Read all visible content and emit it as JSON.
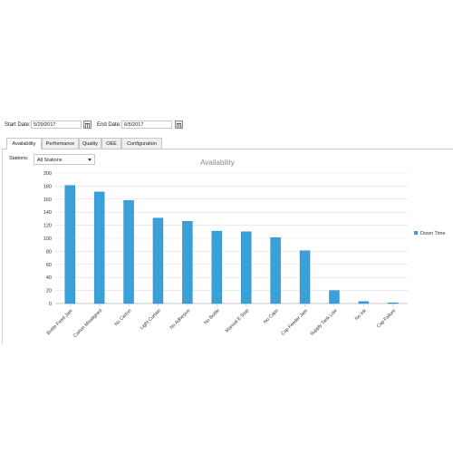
{
  "filters": {
    "start_label": "Start Date:",
    "start_value": "5/29/2017",
    "end_label": "End Date:",
    "end_value": "6/5/2017"
  },
  "tabs": [
    {
      "label": "Availability",
      "active": true
    },
    {
      "label": "Performance",
      "active": false
    },
    {
      "label": "Quality",
      "active": false
    },
    {
      "label": "OEE",
      "active": false
    },
    {
      "label": "Configuration",
      "active": false
    }
  ],
  "stations": {
    "label": "Stations:",
    "selected": "All Stations"
  },
  "colors": {
    "bar": "#3aa0d8",
    "bar_edge": "#1f7fbf",
    "grid": "#e2e2e2",
    "title": "#888888"
  },
  "chart_data": {
    "type": "bar",
    "title": "Availability",
    "categories": [
      "Bottle Feed Jam",
      "Carton Misaligned",
      "No Carton",
      "Light Curtain",
      "No Adhesive",
      "No Bottle",
      "Manual E Stop",
      "No Caps",
      "Cap Feeder Jam",
      "Supply Tank Low",
      "No Ink",
      "Cap Failure"
    ],
    "series": [
      {
        "name": "Down Time",
        "values": [
          181,
          171,
          158,
          131,
          126,
          111,
          110,
          101,
          81,
          20,
          3,
          1
        ]
      }
    ],
    "ylim": [
      0,
      200
    ],
    "yticks": [
      0,
      20,
      40,
      60,
      80,
      100,
      120,
      140,
      160,
      180,
      200
    ],
    "grid": true,
    "legend": "right"
  }
}
